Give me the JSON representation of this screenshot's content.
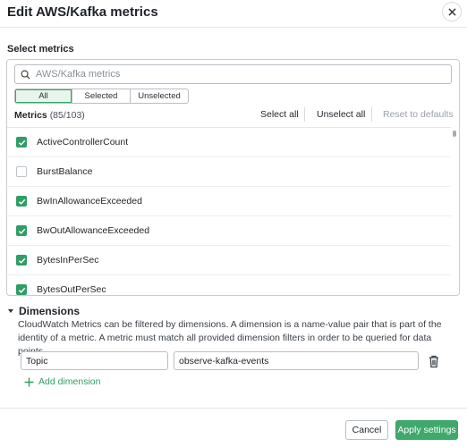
{
  "dialog": {
    "title": "Edit AWS/Kafka metrics",
    "close_icon": "close-icon"
  },
  "select_metrics": {
    "label": "Select metrics",
    "search_placeholder": "AWS/Kafka metrics",
    "filters": [
      "All",
      "Selected",
      "Unselected"
    ],
    "active_filter": "All",
    "metrics_label": "Metrics",
    "metrics_count": "(85/103)",
    "select_all": "Select all",
    "unselect_all": "Unselect all",
    "reset": "Reset to defaults",
    "items": [
      {
        "name": "ActiveControllerCount",
        "checked": true
      },
      {
        "name": "BurstBalance",
        "checked": false
      },
      {
        "name": "BwInAllowanceExceeded",
        "checked": true
      },
      {
        "name": "BwOutAllowanceExceeded",
        "checked": true
      },
      {
        "name": "BytesInPerSec",
        "checked": true
      },
      {
        "name": "BytesOutPerSec",
        "checked": true
      }
    ]
  },
  "dimensions": {
    "title": "Dimensions",
    "description": "CloudWatch Metrics can be filtered by dimensions. A dimension is a name-value pair that is part of the identity of a metric. A metric must match all provided dimension filters in order to be queried for data points.",
    "rows": [
      {
        "name": "Topic",
        "value": "observe-kafka-events"
      }
    ],
    "add_label": "Add dimension"
  },
  "footer": {
    "cancel_label": "Cancel",
    "apply_label": "Apply settings"
  },
  "colors": {
    "accent": "#3fa86c",
    "checkbox": "#2f9e63"
  }
}
